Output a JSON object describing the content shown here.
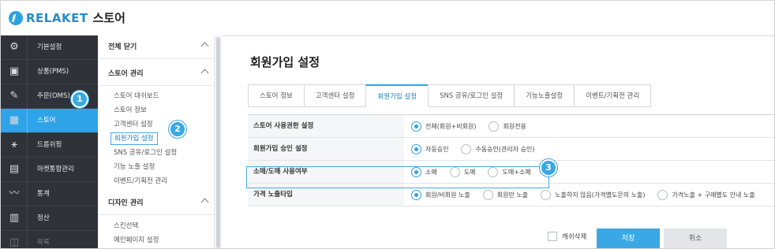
{
  "header": {
    "brand": "RELAKET",
    "product": "스토어"
  },
  "leftnav": {
    "items": [
      {
        "label": "기본설정",
        "icon": "gear-icon",
        "glyph": "⚙"
      },
      {
        "label": "상품(PMS)",
        "icon": "box-icon",
        "glyph": "▣"
      },
      {
        "label": "주문(OMS)",
        "icon": "order-icon",
        "glyph": "✎"
      },
      {
        "label": "스토어",
        "icon": "store-icon",
        "glyph": "▦"
      },
      {
        "label": "드롭쉬핑",
        "icon": "network-icon",
        "glyph": "⚹"
      },
      {
        "label": "마켓통합관리",
        "icon": "market-icon",
        "glyph": "▤"
      },
      {
        "label": "통계",
        "icon": "chart-icon",
        "glyph": "〰"
      },
      {
        "label": "정산",
        "icon": "calculator-icon",
        "glyph": "▥"
      },
      {
        "label": "목록",
        "icon": "list-icon",
        "glyph": "◫"
      }
    ]
  },
  "submenu": {
    "close_all": "전체 닫기",
    "store_section": "스토어 관리",
    "store_links": [
      "스토어 대쉬보드",
      "스토어 정보",
      "고객센터 설정",
      "회원가입 설정",
      "SNS 공유/로그인 설정",
      "기능 노출 설정",
      "이벤트/기획전 관리"
    ],
    "design_section": "디자인 관리",
    "design_links": [
      "스킨선택",
      "메인페이지 설정"
    ]
  },
  "main": {
    "title": "회원가입 설정",
    "tabs": [
      "스토어 정보",
      "고객센터 설정",
      "회원가입 설정",
      "SNS 공유/로그인 설정",
      "기능노출설정",
      "이벤트/기획전 관리"
    ],
    "active_tab": 2,
    "rows": [
      {
        "label": "스토어 사용권한 설정",
        "options": [
          "전체(회원+비회원)",
          "회원전용"
        ],
        "selected": 0
      },
      {
        "label": "회원가입 승인 설정",
        "options": [
          "자동승인",
          "수동승인(관리자 승인)"
        ],
        "selected": 0
      },
      {
        "label": "소매/도매 사용여부",
        "options": [
          "소매",
          "도매",
          "도매+소매"
        ],
        "selected": 0
      },
      {
        "label": "가격 노출타입",
        "options": [
          "회원/비회원 노출",
          "회원만 노출",
          "노출하지 않음(가격별도문의 노출)",
          "가격노출 + 구매별도 안내 노출"
        ],
        "selected": 0
      }
    ],
    "cache_delete": "캐쉬삭제",
    "save": "저장",
    "cancel": "취소"
  },
  "callouts": [
    "1",
    "2",
    "3"
  ],
  "colors": {
    "accent": "#2ea3e8",
    "nav_bg": "#2f3238"
  }
}
